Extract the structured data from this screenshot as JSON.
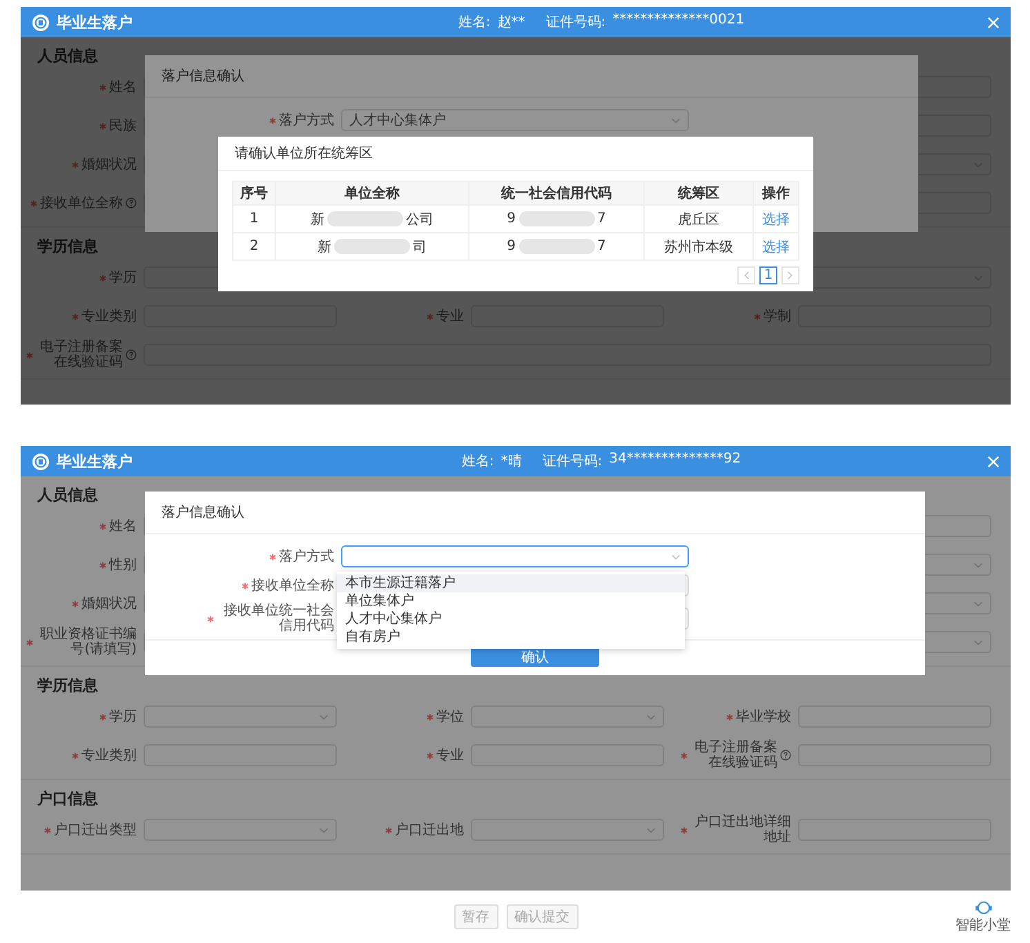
{
  "screens": [
    {
      "header": {
        "title": "毕业生落户",
        "name_label": "姓名:",
        "name_value": "赵**",
        "id_label": "证件号码:",
        "id_value": "**************0021"
      },
      "sections": [
        {
          "title": "人员信息",
          "rows": [
            [
              {
                "label": "姓名",
                "required": true,
                "kind": "input"
              }
            ],
            [
              {
                "label": "民族",
                "required": true,
                "kind": "input"
              }
            ],
            [
              {
                "label": "婚姻状况",
                "required": true,
                "kind": "select"
              }
            ],
            [
              {
                "label": "接收单位全称",
                "required": true,
                "kind": "input",
                "help": true
              }
            ]
          ]
        },
        {
          "title": "学历信息",
          "rows": [
            [
              {
                "label": "学历",
                "required": true,
                "kind": "select"
              }
            ],
            [
              {
                "label": "专业类别",
                "required": true,
                "kind": "input"
              },
              {
                "label": "专业",
                "required": true,
                "kind": "input"
              },
              {
                "label": "学制",
                "required": true,
                "kind": "input"
              }
            ],
            [
              {
                "label": "电子注册备案在线验证码",
                "required": true,
                "kind": "input",
                "help": true
              }
            ]
          ]
        }
      ],
      "confirm_dialog": {
        "title": "落户信息确认",
        "fields": [
          {
            "label": "落户方式",
            "required": true,
            "kind": "select",
            "value": "人才中心集体户",
            "focused": false
          }
        ]
      },
      "unit_dialog": {
        "title": "请确认单位所在统筹区",
        "columns": [
          "序号",
          "单位全称",
          "统一社会信用代码",
          "统筹区",
          "操作"
        ],
        "rows": [
          {
            "index": "1",
            "unit_start": "新",
            "unit_end": "公司",
            "code_start": "9",
            "code_end": "7",
            "district": "虎丘区",
            "action": "选择"
          },
          {
            "index": "2",
            "unit_start": "新",
            "unit_end": "司",
            "code_start": "9",
            "code_end": "7",
            "district": "苏州市本级",
            "action": "选择"
          }
        ],
        "pages": [
          {
            "label": "1",
            "selected": true
          }
        ]
      }
    },
    {
      "header": {
        "title": "毕业生落户",
        "name_label": "姓名:",
        "name_value": "*晴",
        "id_label": "证件号码:",
        "id_value": "34**************92"
      },
      "sections": [
        {
          "title": "人员信息",
          "rows": [
            [
              {
                "label": "姓名",
                "required": true,
                "kind": "input"
              }
            ],
            [
              {
                "label": "性别",
                "required": true,
                "kind": "select"
              }
            ],
            [
              {
                "label": "婚姻状况",
                "required": true,
                "kind": "select"
              }
            ],
            [
              {
                "label": "职业资格证书编号(请填写)",
                "required": true,
                "kind": "select"
              }
            ]
          ]
        },
        {
          "title": "学历信息",
          "rows": [
            [
              {
                "label": "学历",
                "required": true,
                "kind": "select"
              },
              {
                "label": "学位",
                "required": true,
                "kind": "select"
              },
              {
                "label": "毕业学校",
                "required": true,
                "kind": "input"
              }
            ],
            [
              {
                "label": "专业类别",
                "required": true,
                "kind": "input"
              },
              {
                "label": "专业",
                "required": true,
                "kind": "input"
              },
              {
                "label": "电子注册备案在线验证码",
                "required": true,
                "kind": "input",
                "help": true
              }
            ]
          ]
        },
        {
          "title": "户口信息",
          "rows": [
            [
              {
                "label": "户口迁出类型",
                "required": true,
                "kind": "select"
              },
              {
                "label": "户口迁出地",
                "required": true,
                "kind": "select"
              },
              {
                "label": "户口迁出地详细地址",
                "required": true,
                "kind": "input"
              }
            ]
          ]
        }
      ],
      "confirm_dialog": {
        "title": "落户信息确认",
        "fields": [
          {
            "label": "落户方式",
            "required": true,
            "kind": "select",
            "focused": true,
            "options": [
              {
                "label": "本市生源迁籍落户",
                "highlighted": true
              },
              {
                "label": "单位集体户",
                "highlighted": false
              },
              {
                "label": "人才中心集体户",
                "highlighted": false
              },
              {
                "label": "自有房户",
                "highlighted": false
              }
            ]
          },
          {
            "label": "接收单位全称",
            "required": true,
            "kind": "input"
          },
          {
            "label": "接收单位统一社会信用代码",
            "required": true,
            "kind": "input"
          }
        ],
        "button": "确认"
      },
      "footer": {
        "buttons": [
          {
            "label": "暂存",
            "disabled": true
          },
          {
            "label": "确认提交",
            "disabled": true
          }
        ],
        "assistant": "智能小堂"
      }
    }
  ]
}
